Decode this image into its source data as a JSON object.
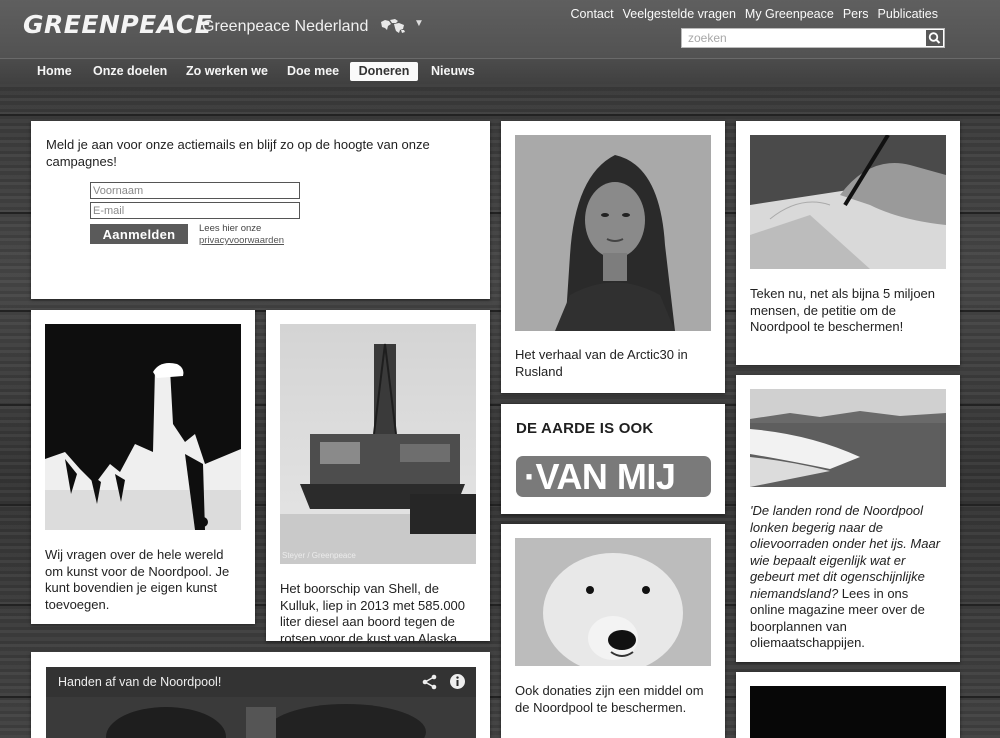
{
  "header": {
    "logo": "GREENPEACE",
    "site_title": "Greenpeace Nederland",
    "region_icon": "world-map-icon",
    "top_links": [
      "Contact",
      "Veelgestelde vragen",
      "My Greenpeace",
      "Pers",
      "Publicaties"
    ],
    "search_placeholder": "zoeken",
    "search_icon": "search-icon"
  },
  "nav": {
    "items": [
      "Home",
      "Onze doelen",
      "Zo werken we",
      "Doe mee",
      "Doneren",
      "Nieuws"
    ],
    "active": "Doneren"
  },
  "signup": {
    "text": "Meld je aan voor onze actiemails en blijf zo op de hoogte van onze campagnes!",
    "first_name_placeholder": "Voornaam",
    "email_placeholder": "E-mail",
    "button": "Aanmelden",
    "privacy_prefix": "Lees hier onze",
    "privacy_link": "privacyvoorwaarden"
  },
  "cards": {
    "arctic30": "Het verhaal van de Arctic30 in Rusland",
    "petition": "Teken nu, net als bijna 5 miljoen mensen, de petitie om de Noordpool te beschermen!",
    "art": "Wij vragen over de hele wereld om kunst voor de Noordpool. Je kunt bovendien je eigen kunst toevoegen.",
    "kulluk": "Het boorschip van Shell, de Kulluk, liep in 2013 met 585.000 liter diesel aan boord tegen de rotsen voor de kust van Alaska.",
    "kulluk_credit": "Steyer / Greenpeace",
    "vanmij_heading": "DE AARDE IS OOK",
    "vanmij_badge": "·VAN MIJ",
    "magazine_italic": "'De landen rond de Noordpool lonken begerig naar de olievoorraden onder het ijs. Maar wie bepaalt eigenlijk wat er gebeurt met dit ogenschijnlijke niemandsland?",
    "magazine_rest": " Lees in ons online magazine meer over de boorplannen van oliemaatschappijen.",
    "donations": "Ook donaties zijn een middel om de Noordpool te beschermen.",
    "video_title": "Handen af van de Noordpool!"
  },
  "colors": {
    "header_bg": "#5a5a5a",
    "nav_bg": "#464646",
    "card_bg": "#ffffff",
    "button_bg": "#5a5a5a"
  }
}
